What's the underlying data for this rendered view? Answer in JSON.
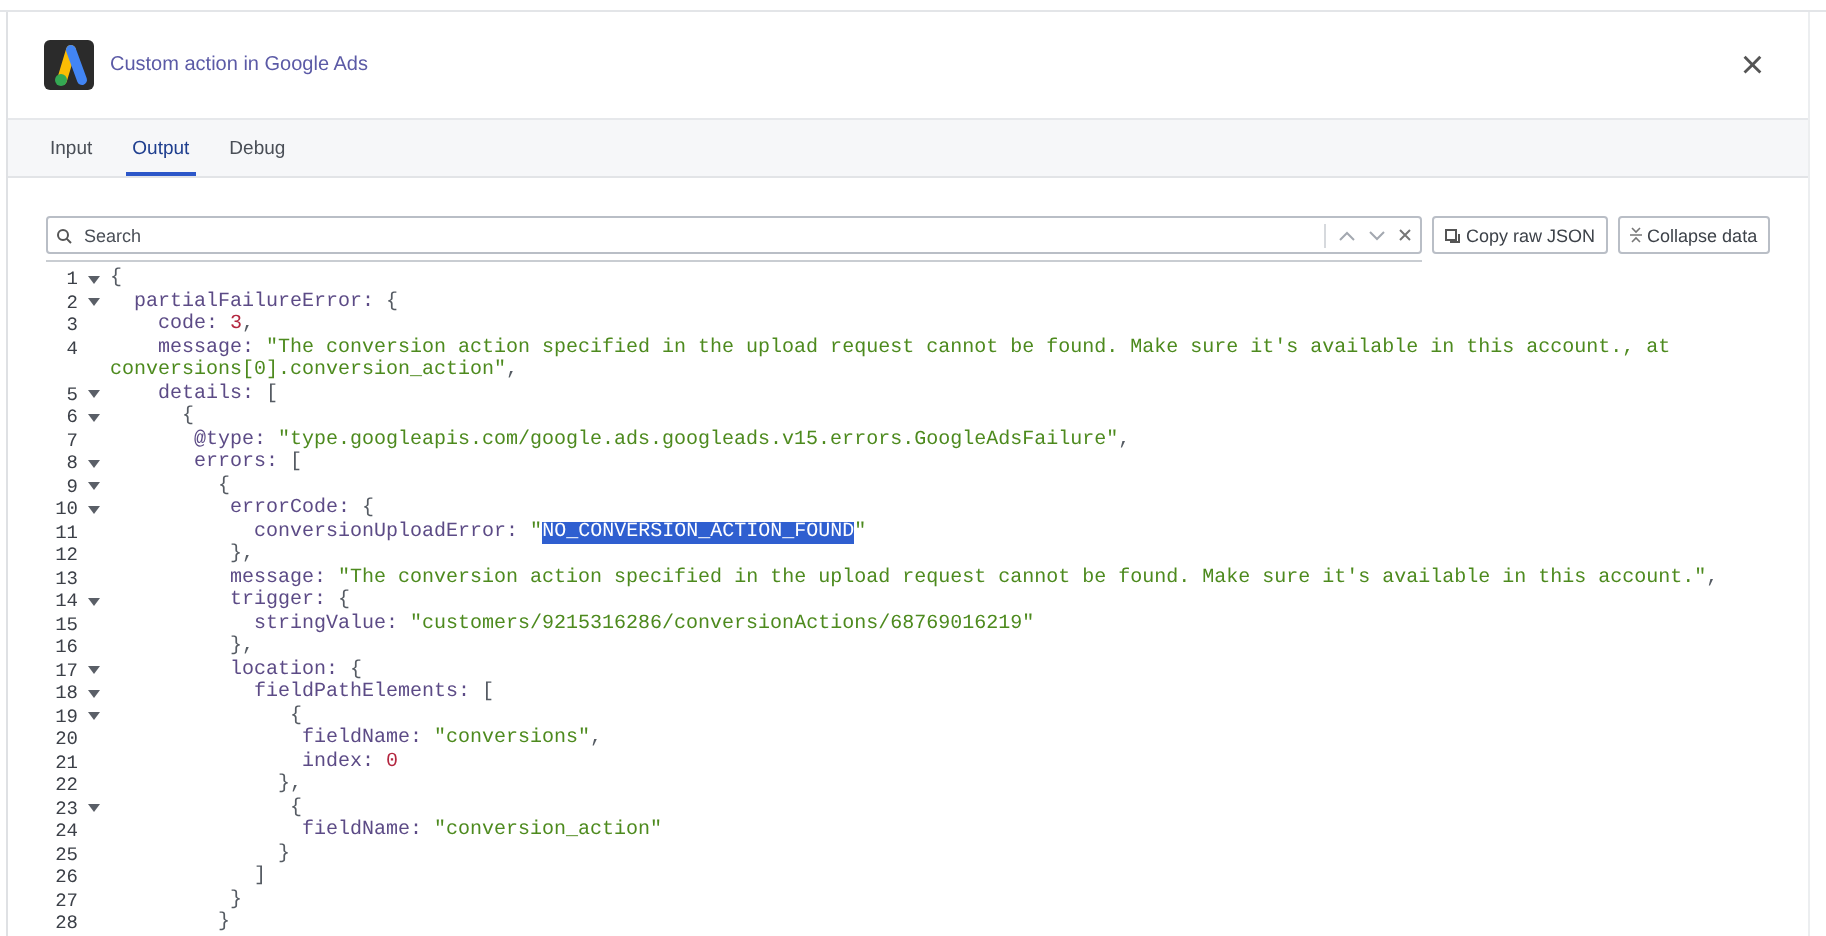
{
  "header": {
    "title": "Custom action in Google Ads",
    "close": "×"
  },
  "tabs": [
    {
      "label": "Input",
      "selected": false
    },
    {
      "label": "Output",
      "selected": true
    },
    {
      "label": "Debug",
      "selected": false
    }
  ],
  "search": {
    "placeholder": "Search"
  },
  "buttons": [
    {
      "label": "Copy raw JSON",
      "kind": "copy"
    },
    {
      "label": "Collapse data",
      "kind": "collapse"
    }
  ],
  "code_lines": [
    {
      "number": "1",
      "foldable": true,
      "tokens": [
        {
          "kind": "punct",
          "text": "{"
        }
      ]
    },
    {
      "number": "2",
      "foldable": true,
      "tokens": [
        {
          "kind": "key",
          "text": "  partialFailureError: "
        },
        {
          "kind": "punct",
          "text": "{"
        }
      ]
    },
    {
      "number": "3",
      "foldable": false,
      "tokens": [
        {
          "kind": "key",
          "text": "    code: "
        },
        {
          "kind": "number",
          "text": "3"
        },
        {
          "kind": "punct",
          "text": ","
        }
      ]
    },
    {
      "number": "4",
      "foldable": false,
      "tokens": [
        {
          "kind": "key",
          "text": "    message: "
        },
        {
          "kind": "string",
          "text": "\"The conversion action specified in the upload request cannot be found. Make sure it's available in this account., at"
        }
      ]
    },
    {
      "foldable": false,
      "tokens": [
        {
          "kind": "string",
          "text": "conversions[0].conversion_action\""
        },
        {
          "kind": "punct",
          "text": ","
        }
      ]
    },
    {
      "number": "5",
      "foldable": true,
      "tokens": [
        {
          "kind": "key",
          "text": "    details: "
        },
        {
          "kind": "punct",
          "text": "["
        }
      ]
    },
    {
      "number": "6",
      "foldable": true,
      "tokens": [
        {
          "kind": "punct",
          "text": "      {"
        }
      ]
    },
    {
      "number": "7",
      "foldable": false,
      "tokens": [
        {
          "kind": "key",
          "text": "       @type: "
        },
        {
          "kind": "string",
          "text": "\"type.googleapis.com/google.ads.googleads.v15.errors.GoogleAdsFailure\""
        },
        {
          "kind": "punct",
          "text": ","
        }
      ]
    },
    {
      "number": "8",
      "foldable": true,
      "tokens": [
        {
          "kind": "key",
          "text": "       errors: "
        },
        {
          "kind": "punct",
          "text": "["
        }
      ]
    },
    {
      "number": "9",
      "foldable": true,
      "tokens": [
        {
          "kind": "punct",
          "text": "         {"
        }
      ]
    },
    {
      "number": "10",
      "foldable": true,
      "tokens": [
        {
          "kind": "key",
          "text": "          errorCode: "
        },
        {
          "kind": "punct",
          "text": "{"
        }
      ]
    },
    {
      "number": "11",
      "foldable": false,
      "tokens": [
        {
          "kind": "key",
          "text": "            conversionUploadError: "
        },
        {
          "kind": "string",
          "text": "\""
        },
        {
          "kind": "selection",
          "text": "NO_CONVERSION_ACTION_FOUND"
        },
        {
          "kind": "string",
          "text": "\""
        }
      ]
    },
    {
      "number": "12",
      "foldable": false,
      "tokens": [
        {
          "kind": "punct",
          "text": "          },"
        }
      ]
    },
    {
      "number": "13",
      "foldable": false,
      "tokens": [
        {
          "kind": "key",
          "text": "          message: "
        },
        {
          "kind": "string",
          "text": "\"The conversion action specified in the upload request cannot be found. Make sure it's available in this account.\""
        },
        {
          "kind": "punct",
          "text": ","
        }
      ]
    },
    {
      "number": "14",
      "foldable": true,
      "tokens": [
        {
          "kind": "key",
          "text": "          trigger: "
        },
        {
          "kind": "punct",
          "text": "{"
        }
      ]
    },
    {
      "number": "15",
      "foldable": false,
      "tokens": [
        {
          "kind": "key",
          "text": "            stringValue: "
        },
        {
          "kind": "string",
          "text": "\"customers/9215316286/conversionActions/68769016219\""
        }
      ]
    },
    {
      "number": "16",
      "foldable": false,
      "tokens": [
        {
          "kind": "punct",
          "text": "          },"
        }
      ]
    },
    {
      "number": "17",
      "foldable": true,
      "tokens": [
        {
          "kind": "key",
          "text": "          location: "
        },
        {
          "kind": "punct",
          "text": "{"
        }
      ]
    },
    {
      "number": "18",
      "foldable": true,
      "tokens": [
        {
          "kind": "key",
          "text": "            fieldPathElements: "
        },
        {
          "kind": "punct",
          "text": "["
        }
      ]
    },
    {
      "number": "19",
      "foldable": true,
      "tokens": [
        {
          "kind": "punct",
          "text": "               {"
        }
      ]
    },
    {
      "number": "20",
      "foldable": false,
      "tokens": [
        {
          "kind": "key",
          "text": "                fieldName: "
        },
        {
          "kind": "string",
          "text": "\"conversions\""
        },
        {
          "kind": "punct",
          "text": ","
        }
      ]
    },
    {
      "number": "21",
      "foldable": false,
      "tokens": [
        {
          "kind": "key",
          "text": "                index: "
        },
        {
          "kind": "number",
          "text": "0"
        }
      ]
    },
    {
      "number": "22",
      "foldable": false,
      "tokens": [
        {
          "kind": "punct",
          "text": "              },"
        }
      ]
    },
    {
      "number": "23",
      "foldable": true,
      "tokens": [
        {
          "kind": "punct",
          "text": "               {"
        }
      ]
    },
    {
      "number": "24",
      "foldable": false,
      "tokens": [
        {
          "kind": "key",
          "text": "                fieldName: "
        },
        {
          "kind": "string",
          "text": "\"conversion_action\""
        }
      ]
    },
    {
      "number": "25",
      "foldable": false,
      "tokens": [
        {
          "kind": "punct",
          "text": "              }"
        }
      ]
    },
    {
      "number": "26",
      "foldable": false,
      "tokens": [
        {
          "kind": "punct",
          "text": "            ]"
        }
      ]
    },
    {
      "number": "27",
      "foldable": false,
      "tokens": [
        {
          "kind": "punct",
          "text": "          }"
        }
      ]
    },
    {
      "number": "28",
      "foldable": false,
      "tokens": [
        {
          "kind": "punct",
          "text": "         }"
        }
      ]
    }
  ]
}
